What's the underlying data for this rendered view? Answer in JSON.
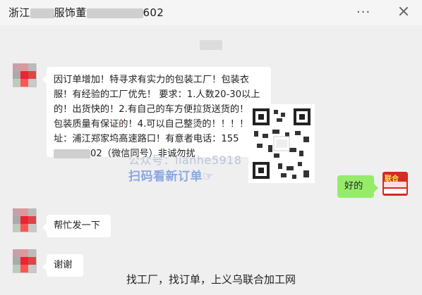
{
  "header": {
    "title_prefix": "浙江",
    "title_middle": "服饰董",
    "title_suffix": "602",
    "more_icon": "more-icon",
    "close_icon": "close-icon"
  },
  "messages": [
    {
      "sender": "other",
      "text": "因订单增加！特寻求有实力的包装工厂！包装衣服！有经验的工厂优先！ 要求：1.人数20-30以上的！出货快的！2.有自己的车方便拉货送货的！3.包装质量有保证的！4.可以自己整烫的！！！！地址：浦江郑家坞高速路口！有意者电话：155",
      "text_tail": "02（微信同号）非诚勿扰"
    },
    {
      "sender": "me",
      "text": "好的"
    },
    {
      "sender": "other",
      "text": "帮忙发一下"
    },
    {
      "sender": "other",
      "text": "谢谢"
    }
  ],
  "watermark": {
    "account": "公众号：lianhe5918",
    "cta": "扫码看新订单☞"
  },
  "logo": {
    "text": "联合"
  },
  "footer": {
    "text": "找工厂，找订单，上义乌联合加工网"
  }
}
